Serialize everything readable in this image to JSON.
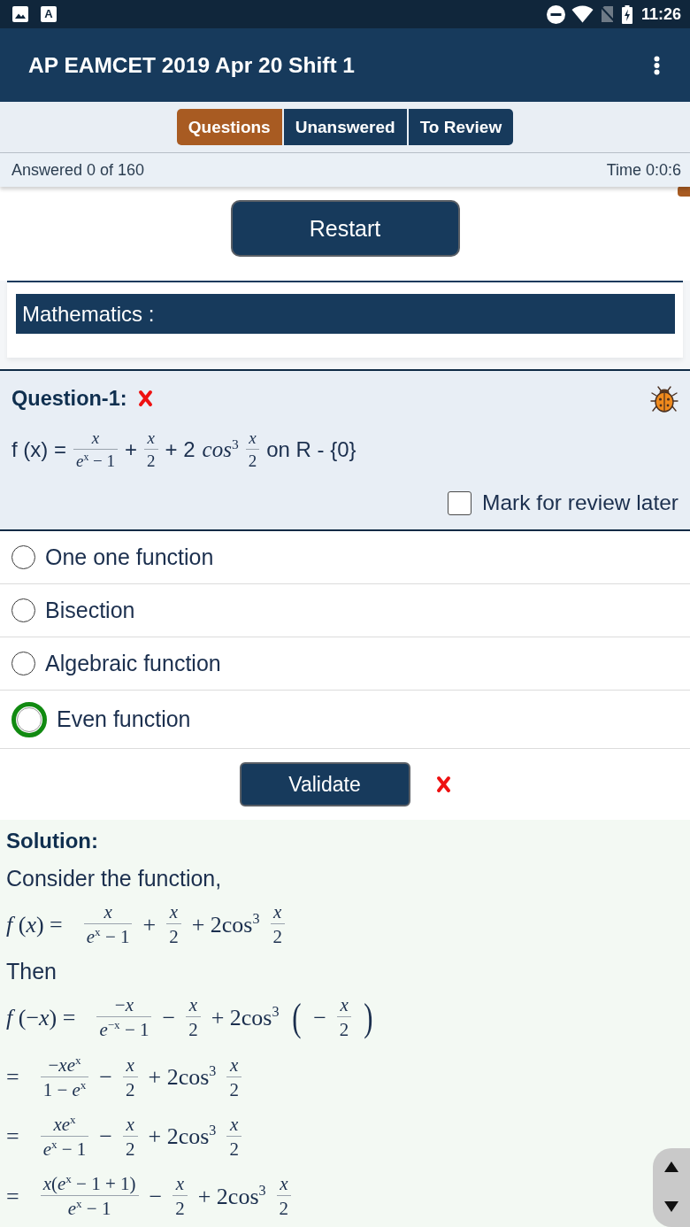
{
  "status_bar": {
    "letter_badge": "A",
    "time": "11:26"
  },
  "app_bar": {
    "title": "AP EAMCET 2019 Apr 20 Shift 1"
  },
  "tabs": [
    {
      "label": "Questions",
      "selected": true
    },
    {
      "label": "Unanswered",
      "selected": false
    },
    {
      "label": "To Review",
      "selected": false
    }
  ],
  "progress": {
    "answered": "Answered 0 of 160",
    "time": "Time 0:0:6"
  },
  "restart_button": {
    "label": "Restart"
  },
  "section": {
    "title": "Mathematics :"
  },
  "question": {
    "title": "Question-1:",
    "correct": false,
    "formula": [
      {
        "kind": "text",
        "text": "f (x) ="
      },
      {
        "kind": "frac",
        "num": {
          "text": "x",
          "italic": true
        },
        "den": {
          "text": "*e*$^{x}$ − 1",
          "italic": false
        }
      },
      {
        "kind": "text",
        "text": "+"
      },
      {
        "kind": "frac",
        "num": {
          "text": "x",
          "italic": true
        },
        "den": {
          "text": "2",
          "italic": false
        }
      },
      {
        "kind": "text",
        "text": "+ 2"
      },
      {
        "kind": "math",
        "text": "*cos*$^{3}$"
      },
      {
        "kind": "frac",
        "num": {
          "text": "x",
          "italic": true
        },
        "den": {
          "text": "2",
          "italic": false
        }
      },
      {
        "kind": "text",
        "text": "on R - {0}"
      }
    ],
    "mark_review": {
      "label": "Mark for review later",
      "checked": false
    }
  },
  "options": [
    {
      "label": "One one function",
      "selected": false,
      "correct": false
    },
    {
      "label": "Bisection",
      "selected": false,
      "correct": false
    },
    {
      "label": "Algebraic function",
      "selected": false,
      "correct": false
    },
    {
      "label": "Even function",
      "selected": false,
      "correct": true
    }
  ],
  "validate": {
    "label": "Validate",
    "correct": false
  },
  "solution": {
    "title": "Solution:",
    "lines": [
      {
        "kind": "text",
        "text": "Consider the function,"
      },
      {
        "kind": "equation",
        "lhs": "*f* (*x*) =",
        "terms": [
          {
            "kind": "frac",
            "num": {
              "text": "x",
              "italic": true
            },
            "den": {
              "text": "*e*$^{x}$ − 1",
              "italic": false
            }
          },
          {
            "kind": "math",
            "text": "+"
          },
          {
            "kind": "frac",
            "num": {
              "text": "x",
              "italic": true
            },
            "den": {
              "text": "2",
              "italic": false
            }
          },
          {
            "kind": "math",
            "text": "+ 2cos$^{3}$"
          },
          {
            "kind": "frac",
            "num": {
              "text": "x",
              "italic": true
            },
            "den": {
              "text": "2",
              "italic": false
            }
          }
        ]
      },
      {
        "kind": "text",
        "text": "Then"
      },
      {
        "kind": "equation",
        "lhs": "*f* (−*x*) =",
        "terms": [
          {
            "kind": "frac",
            "num": {
              "text": "−*x*",
              "italic": false
            },
            "den": {
              "text": "*e*$^{−x}$ − 1",
              "italic": false
            }
          },
          {
            "kind": "math",
            "text": "−"
          },
          {
            "kind": "frac",
            "num": {
              "text": "x",
              "italic": true
            },
            "den": {
              "text": "2",
              "italic": false
            }
          },
          {
            "kind": "math",
            "text": "+ 2cos$^{3}$"
          },
          {
            "kind": "group",
            "open": "(",
            "close": ")",
            "terms": [
              {
                "kind": "math",
                "text": "−"
              },
              {
                "kind": "frac",
                "num": {
                  "text": "x",
                  "italic": true
                },
                "den": {
                  "text": "2",
                  "italic": false
                }
              }
            ]
          }
        ]
      },
      {
        "kind": "equation",
        "lhs": "=",
        "terms": [
          {
            "kind": "frac",
            "num": {
              "text": "−*xe*$^{x}$",
              "italic": false
            },
            "den": {
              "text": "1 − *e*$^{x}$",
              "italic": false
            }
          },
          {
            "kind": "math",
            "text": "−"
          },
          {
            "kind": "frac",
            "num": {
              "text": "x",
              "italic": true
            },
            "den": {
              "text": "2",
              "italic": false
            }
          },
          {
            "kind": "math",
            "text": "+ 2cos$^{3}$"
          },
          {
            "kind": "frac",
            "num": {
              "text": "x",
              "italic": true
            },
            "den": {
              "text": "2",
              "italic": false
            }
          }
        ]
      },
      {
        "kind": "equation",
        "lhs": "=",
        "terms": [
          {
            "kind": "frac",
            "num": {
              "text": "*xe*$^{x}$",
              "italic": false
            },
            "den": {
              "text": "*e*$^{x}$ − 1",
              "italic": false
            }
          },
          {
            "kind": "math",
            "text": "−"
          },
          {
            "kind": "frac",
            "num": {
              "text": "x",
              "italic": true
            },
            "den": {
              "text": "2",
              "italic": false
            }
          },
          {
            "kind": "math",
            "text": "+ 2cos$^{3}$"
          },
          {
            "kind": "frac",
            "num": {
              "text": "x",
              "italic": true
            },
            "den": {
              "text": "2",
              "italic": false
            }
          }
        ]
      },
      {
        "kind": "equation",
        "lhs": "=",
        "terms": [
          {
            "kind": "frac",
            "num": {
              "text": "*x*(*e*$^{x}$ − 1 + 1)",
              "italic": false
            },
            "den": {
              "text": "*e*$^{x}$ − 1",
              "italic": false
            }
          },
          {
            "kind": "math",
            "text": "−"
          },
          {
            "kind": "frac",
            "num": {
              "text": "x",
              "italic": true
            },
            "den": {
              "text": "2",
              "italic": false
            }
          },
          {
            "kind": "math",
            "text": "+ 2cos$^{3}$"
          },
          {
            "kind": "frac",
            "num": {
              "text": "x",
              "italic": true
            },
            "den": {
              "text": "2",
              "italic": false
            }
          }
        ]
      }
    ]
  }
}
